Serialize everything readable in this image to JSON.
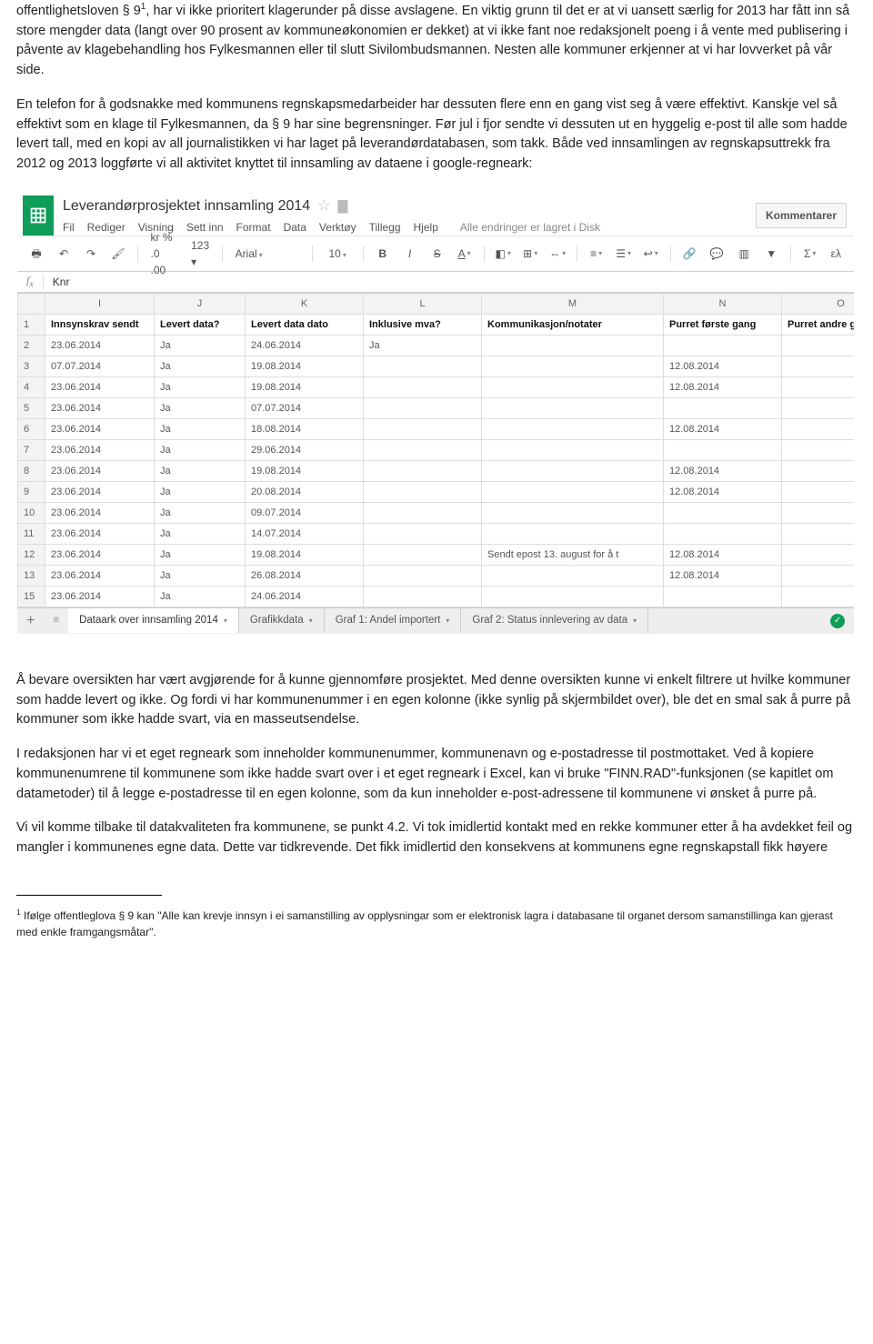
{
  "prose": {
    "p1a": "offentlighetsloven § 9",
    "p1sup": "1",
    "p1b": ", har vi ikke prioritert klagerunder på disse avslagene. En viktig grunn til det er at vi uansett særlig for 2013 har fått inn så store mengder data (langt over 90 prosent av kommuneøkonomien er dekket) at vi ikke fant noe redaksjonelt poeng i å vente med publisering i påvente av klagebehandling hos Fylkesmannen eller til slutt Sivilombudsmannen. Nesten alle kommuner erkjenner at vi har lovverket på vår side.",
    "p2": "En telefon for å godsnakke med kommunens regnskapsmedarbeider har dessuten flere enn en gang vist seg å være effektivt. Kanskje vel så effektivt som en klage til Fylkesmannen, da § 9 har sine begrensninger. Før jul i fjor sendte vi dessuten ut en hyggelig e-post til alle som hadde levert tall, med en kopi av all journalistikken vi har laget på leverandørdatabasen, som takk. Både ved innsamlingen av regnskapsuttrekk fra 2012 og 2013 loggførte vi all aktivitet knyttet til innsamling av dataene i google-regneark:",
    "p3": "Å bevare oversikten har vært avgjørende for å kunne gjennomføre prosjektet. Med denne oversikten kunne vi enkelt filtrere ut hvilke kommuner som hadde levert og ikke. Og fordi vi har kommunenummer i en egen kolonne (ikke synlig på skjermbildet over), ble det en smal sak å purre på kommuner som ikke hadde svart, via en masseutsendelse.",
    "p4": "I redaksjonen har vi et eget regneark som inneholder kommunenummer, kommunenavn og e-postadresse til postmottaket. Ved å kopiere kommunenumrene til kommunene som ikke hadde svart over i et eget regneark i Excel, kan vi bruke \"FINN.RAD\"-funksjonen (se kapitlet om datametoder) til å legge e-postadresse til en egen kolonne, som da kun inneholder e-post-adressene til kommunene vi ønsket å purre på.",
    "p5": "Vi vil komme tilbake til datakvaliteten fra kommunene, se punkt 4.2. Vi tok imidlertid kontakt med en rekke kommuner etter å ha avdekket feil og mangler i kommunenes egne data. Dette var tidkrevende. Det fikk imidlertid den konsekvens at kommunens egne regnskapstall fikk høyere",
    "footnote_marker": "1",
    "footnote": " Ifølge offentleglova § 9 kan \"Alle kan krevje innsyn i ei samanstilling av opplysningar som er elektronisk lagra i databasane til organet dersom samanstillinga kan gjerast med enkle framgangsmåtar\"."
  },
  "sheets": {
    "title": "Leverandørprosjektet innsamling 2014",
    "menu": [
      "Fil",
      "Rediger",
      "Visning",
      "Sett inn",
      "Format",
      "Data",
      "Verktøy",
      "Tillegg",
      "Hjelp"
    ],
    "saved_text": "Alle endringer er lagret i Disk",
    "comments_btn": "Kommentarer",
    "toolbar": {
      "zoom": "123 ▾",
      "currency_fmt": "kr  %  .0  .00",
      "font_name": "Arial",
      "font_size": "10",
      "greek": "ελ"
    },
    "fx_value": "Knr",
    "columns": [
      "",
      "I",
      "J",
      "K",
      "L",
      "M",
      "N",
      "O"
    ],
    "header_row": [
      "1",
      "Innsynskrav sendt",
      "Levert data?",
      "Levert data dato",
      "Inklusive mva?",
      "Kommunikasjon/notater",
      "Purret første gang",
      "Purret andre gang"
    ],
    "rows": [
      {
        "n": "2",
        "cells": [
          "23.06.2014",
          "Ja",
          "24.06.2014",
          "Ja",
          "",
          "",
          ""
        ]
      },
      {
        "n": "3",
        "cells": [
          "07.07.2014",
          "Ja",
          "19.08.2014",
          "",
          "",
          "12.08.2014",
          ""
        ]
      },
      {
        "n": "4",
        "cells": [
          "23.06.2014",
          "Ja",
          "19.08.2014",
          "",
          "",
          "12.08.2014",
          ""
        ]
      },
      {
        "n": "5",
        "cells": [
          "23.06.2014",
          "Ja",
          "07.07.2014",
          "",
          "",
          "",
          ""
        ]
      },
      {
        "n": "6",
        "cells": [
          "23.06.2014",
          "Ja",
          "18.08.2014",
          "",
          "",
          "12.08.2014",
          ""
        ]
      },
      {
        "n": "7",
        "cells": [
          "23.06.2014",
          "Ja",
          "29.06.2014",
          "",
          "",
          "",
          ""
        ]
      },
      {
        "n": "8",
        "cells": [
          "23.06.2014",
          "Ja",
          "19.08.2014",
          "",
          "",
          "12.08.2014",
          ""
        ]
      },
      {
        "n": "9",
        "cells": [
          "23.06.2014",
          "Ja",
          "20.08.2014",
          "",
          "",
          "12.08.2014",
          ""
        ]
      },
      {
        "n": "10",
        "cells": [
          "23.06.2014",
          "Ja",
          "09.07.2014",
          "",
          "",
          "",
          ""
        ]
      },
      {
        "n": "11",
        "cells": [
          "23.06.2014",
          "Ja",
          "14.07.2014",
          "",
          "",
          "",
          ""
        ]
      },
      {
        "n": "12",
        "cells": [
          "23.06.2014",
          "Ja",
          "19.08.2014",
          "",
          "Sendt epost 13. august for å t",
          "12.08.2014",
          ""
        ]
      },
      {
        "n": "13",
        "cells": [
          "23.06.2014",
          "Ja",
          "26.08.2014",
          "",
          "",
          "12.08.2014",
          ""
        ]
      },
      {
        "n": "15",
        "cells": [
          "23.06.2014",
          "Ja",
          "24.06.2014",
          "",
          "",
          "",
          ""
        ]
      }
    ],
    "tabs": [
      {
        "label": "Dataark over innsamling 2014",
        "active": true
      },
      {
        "label": "Grafikkdata",
        "active": false
      },
      {
        "label": "Graf 1: Andel importert",
        "active": false
      },
      {
        "label": "Graf 2: Status innlevering av data",
        "active": false
      }
    ]
  }
}
